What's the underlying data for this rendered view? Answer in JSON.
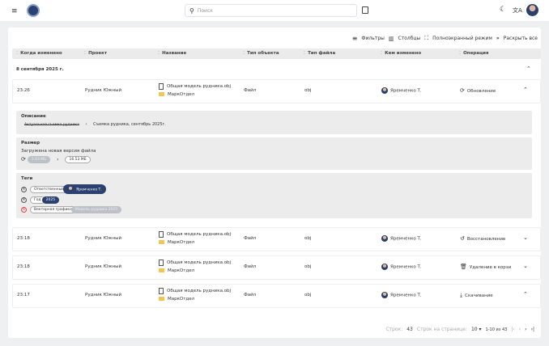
{
  "header": {
    "search_placeholder": "Поиск"
  },
  "toolbar": {
    "filters": "Фильтры",
    "columns": "Столбцы",
    "fullscreen": "Полноэкранный режим",
    "expand_all": "Раскрыть все"
  },
  "columns": [
    "Когда изменено",
    "Проект",
    "Название",
    "Тип объекта",
    "Тип файла",
    "Кем изменено",
    "Операция"
  ],
  "group": {
    "date": "8 сентября 2025 г."
  },
  "rows": [
    {
      "time": "23:26",
      "project": "Рудник Южный",
      "file": "Общая модель рудника.obj",
      "folder": "МаркОтдел",
      "object_type": "Файл",
      "file_type": "obj",
      "user": "Яремченко Т.",
      "operation": "Обновление",
      "operation_icon": "refresh-icon",
      "expanded": true
    },
    {
      "time": "23:18",
      "project": "Рудник Южный",
      "file": "Общая модель рудника.obj",
      "folder": "МаркОтдел",
      "object_type": "Файл",
      "file_type": "obj",
      "user": "Яремченко Т.",
      "operation": "Восстановление",
      "operation_icon": "restore-icon",
      "expanded": false
    },
    {
      "time": "23:18",
      "project": "Рудник Южный",
      "file": "Общая модель рудника.obj",
      "folder": "МаркОтдел",
      "object_type": "Файл",
      "file_type": "obj",
      "user": "Яремченко Т.",
      "operation": "Удаление в корзи",
      "operation_icon": "trash-icon",
      "expanded": false
    },
    {
      "time": "23:17",
      "project": "Рудник Южный",
      "file": "Общая модель рудника.obj",
      "folder": "МаркОтдел",
      "object_type": "Файл",
      "file_type": "obj",
      "user": "Яремченко Т.",
      "operation": "Скачивание",
      "operation_icon": "download-icon",
      "expanded": true
    }
  ],
  "details": {
    "description": {
      "title": "Описание",
      "old": "Актуальная съемка рудника",
      "new": "Съемка рудника, сентябрь 2025г."
    },
    "size": {
      "title": "Размер",
      "text": "Загружена новая версия файла",
      "old": "1.03 МБ",
      "new": "16.53 МБ"
    },
    "tags": {
      "title": "Теги",
      "items": [
        {
          "key": "Ответственный",
          "value": "Яремченко Т.",
          "state": "added"
        },
        {
          "key": "Год",
          "value": "2025",
          "state": "added"
        },
        {
          "key": "Векторная графика",
          "value": "Модель рудника 2025",
          "state": "removed"
        }
      ]
    }
  },
  "footer": {
    "rows_label": "Строк:",
    "rows_count": "43",
    "per_page_label": "Строк на странице:",
    "per_page": "10",
    "range": "1-10 из 43"
  },
  "colors": {
    "accent": "#2b4170",
    "removed": "#e04545",
    "folder": "#f5c452"
  }
}
